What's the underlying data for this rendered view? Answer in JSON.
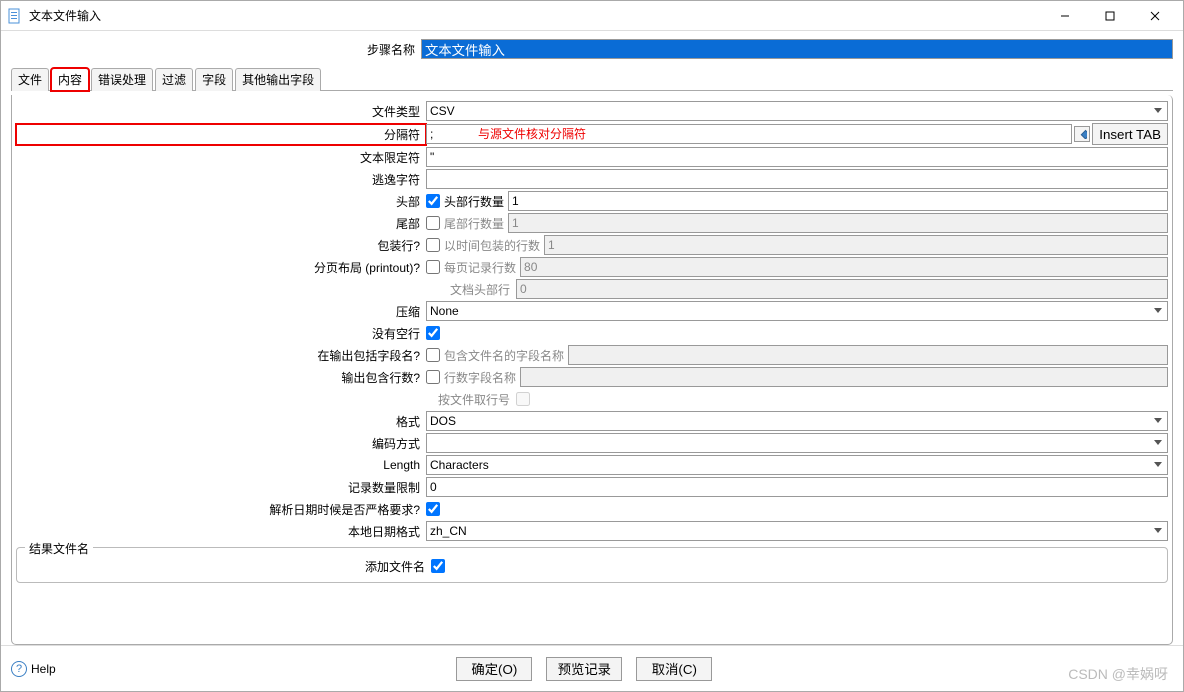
{
  "window": {
    "title": "文本文件输入"
  },
  "stepName": {
    "label": "步骤名称",
    "value": "文本文件输入"
  },
  "tabs": [
    "文件",
    "内容",
    "错误处理",
    "过滤",
    "字段",
    "其他输出字段"
  ],
  "activeTab": 1,
  "fields": {
    "fileType": {
      "label": "文件类型",
      "value": "CSV"
    },
    "separator": {
      "label": "分隔符",
      "value": ";",
      "annotation": "与源文件核对分隔符",
      "insert": "Insert TAB"
    },
    "enclosure": {
      "label": "文本限定符",
      "value": "\""
    },
    "escape": {
      "label": "逃逸字符",
      "value": ""
    },
    "header": {
      "label": "头部",
      "checkLabel": "头部行数量",
      "checked": true,
      "value": "1"
    },
    "footer": {
      "label": "尾部",
      "checkLabel": "尾部行数量",
      "checked": false,
      "value": "1"
    },
    "wrap": {
      "label": "包装行?",
      "checkLabel": "以时间包装的行数",
      "checked": false,
      "value": "1"
    },
    "paged": {
      "label": "分页布局 (printout)?",
      "checkLabel": "每页记录行数",
      "checked": false,
      "value": "80"
    },
    "docHeader": {
      "label": "文档头部行",
      "value": "0"
    },
    "compression": {
      "label": "压缩",
      "value": "None"
    },
    "noEmpty": {
      "label": "没有空行",
      "checked": true
    },
    "includeFilename": {
      "label": "在输出包括字段名?",
      "checkLabel": "包含文件名的字段名称",
      "checked": false,
      "value": ""
    },
    "includeRownum": {
      "label": "输出包含行数?",
      "checkLabel": "行数字段名称",
      "checked": false,
      "value": ""
    },
    "rownumByFile": {
      "label": "按文件取行号",
      "checked": false
    },
    "format": {
      "label": "格式",
      "value": "DOS"
    },
    "encoding": {
      "label": "编码方式",
      "value": ""
    },
    "length": {
      "label": "Length",
      "value": "Characters"
    },
    "limit": {
      "label": "记录数量限制",
      "value": "0"
    },
    "strictDate": {
      "label": "解析日期时候是否严格要求?",
      "checked": true
    },
    "dateLocale": {
      "label": "本地日期格式",
      "value": "zh_CN"
    }
  },
  "resultFile": {
    "legend": "结果文件名",
    "addLabel": "添加文件名",
    "checked": true
  },
  "buttons": {
    "ok": "确定(O)",
    "preview": "预览记录",
    "cancel": "取消(C)"
  },
  "help": "Help",
  "watermark": "CSDN @幸娲呀"
}
